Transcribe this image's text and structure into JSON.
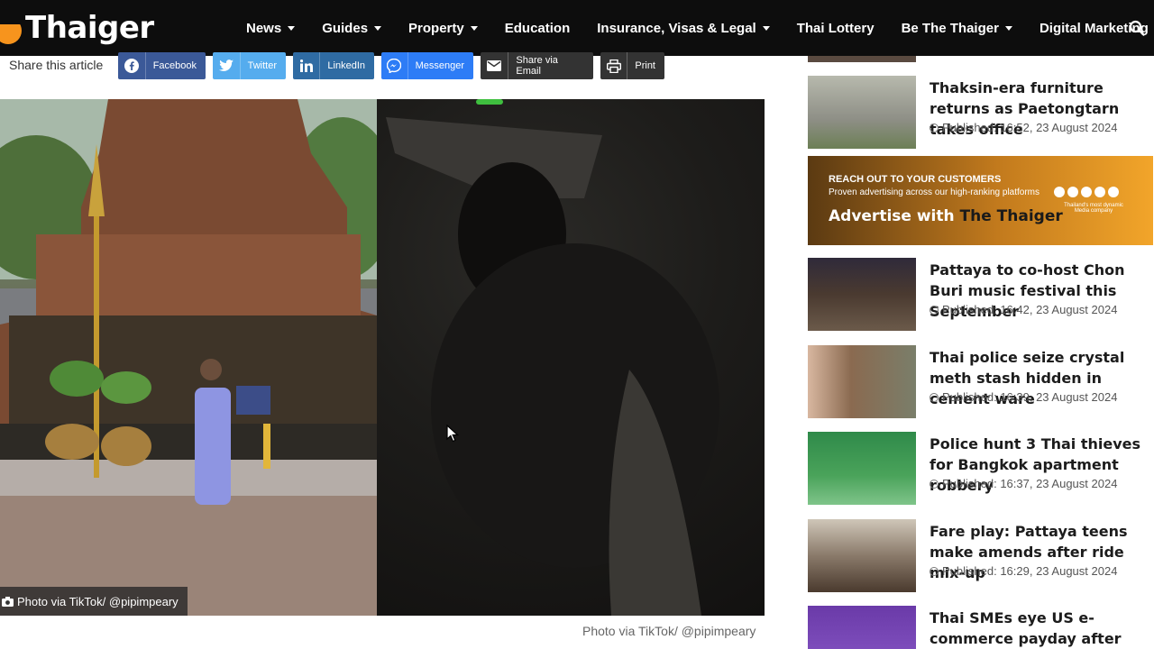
{
  "brand": {
    "name": "Thaiger"
  },
  "nav": {
    "items": [
      {
        "label": "News",
        "dropdown": true
      },
      {
        "label": "Guides",
        "dropdown": true
      },
      {
        "label": "Property",
        "dropdown": true
      },
      {
        "label": "Education",
        "dropdown": false
      },
      {
        "label": "Insurance, Visas & Legal",
        "dropdown": true
      },
      {
        "label": "Thai Lottery",
        "dropdown": false
      },
      {
        "label": "Be The Thaiger",
        "dropdown": true
      },
      {
        "label": "Digital Marketing",
        "dropdown": false
      }
    ],
    "search_icon": "search-icon"
  },
  "share": {
    "label": "Share this article",
    "buttons": [
      {
        "label": "Facebook",
        "color": "#3b5998",
        "icon": "facebook-icon"
      },
      {
        "label": "Twitter",
        "color": "#55acee",
        "icon": "twitter-icon"
      },
      {
        "label": "LinkedIn",
        "color": "#2f6ba3",
        "icon": "linkedin-icon"
      },
      {
        "label": "Messenger",
        "color": "#2d7cf6",
        "icon": "messenger-icon"
      },
      {
        "label": "Share via Email",
        "color": "#333333",
        "icon": "email-icon"
      },
      {
        "label": "Print",
        "color": "#333333",
        "icon": "print-icon"
      }
    ]
  },
  "article": {
    "photo_credit": "Photo via TikTok/ @pipimpeary",
    "caption": "Photo via TikTok/ @pipimpeary"
  },
  "sidebar": {
    "items": [
      {
        "title": "Thaksin-era furniture returns as Paetongtarn takes office",
        "published": "Published: 16:52, 23 August 2024"
      },
      {
        "title": "Pattaya to co-host Chon Buri music festival this September",
        "published": "Published: 16:42, 23 August 2024"
      },
      {
        "title": "Thai police seize crystal meth stash hidden in cement ware",
        "published": "Published: 16:39, 23 August 2024"
      },
      {
        "title": "Police hunt 3 Thai thieves for Bangkok apartment robbery",
        "published": "Published: 16:37, 23 August 2024"
      },
      {
        "title": "Fare play: Pattaya teens make amends after ride mix-up",
        "published": "Published: 16:29, 23 August 2024"
      },
      {
        "title": "Thai SMEs eye US e-commerce payday after major Amazon",
        "published": ""
      }
    ],
    "ad": {
      "line1": "REACH OUT TO YOUR CUSTOMERS",
      "line2": "Proven advertising across our high-ranking platforms",
      "cta_prefix": "Advertise with",
      "cta_brand": "The Thaiger",
      "tagline": "Thailand's most dynamic Media company"
    }
  }
}
